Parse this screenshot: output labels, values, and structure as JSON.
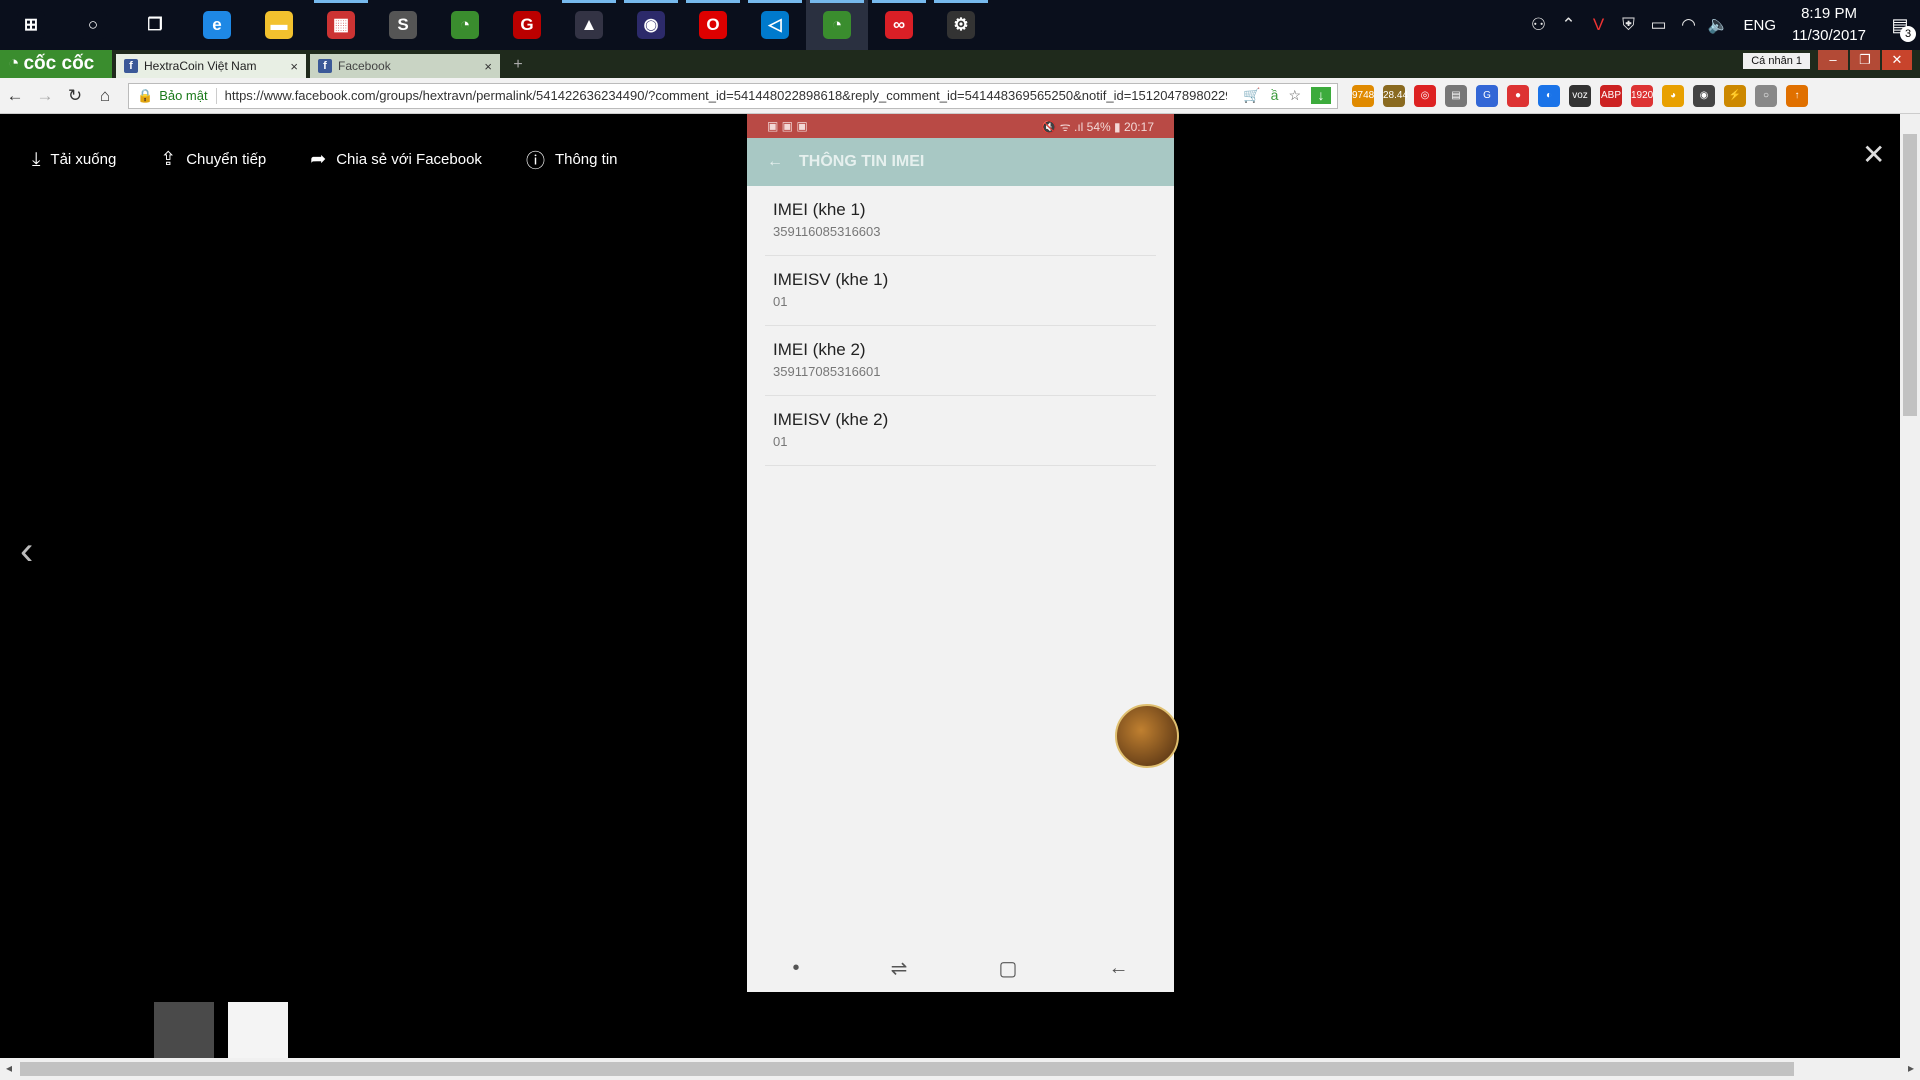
{
  "taskbar": {
    "icons": [
      {
        "name": "start-icon",
        "glyph": "⊞",
        "color": "#0a0f1c"
      },
      {
        "name": "cortana-icon",
        "glyph": "○",
        "color": "#0a0f1c"
      },
      {
        "name": "task-view-icon",
        "glyph": "❐",
        "color": "#0a0f1c"
      },
      {
        "name": "edge-icon",
        "glyph": "e",
        "color": "#1e88e5"
      },
      {
        "name": "file-explorer-icon",
        "glyph": "▬",
        "color": "#f2c12e"
      },
      {
        "name": "app-icon-1",
        "glyph": "▦",
        "color": "#c33"
      },
      {
        "name": "sublime-icon",
        "glyph": "S",
        "color": "#555"
      },
      {
        "name": "coccoc-icon",
        "glyph": "◔",
        "color": "#3a8d2e"
      },
      {
        "name": "garena-icon",
        "glyph": "G",
        "color": "#b00"
      },
      {
        "name": "app-icon-2",
        "glyph": "▲",
        "color": "#334"
      },
      {
        "name": "eclipse-icon",
        "glyph": "◉",
        "color": "#2c2a6a"
      },
      {
        "name": "opera-icon",
        "glyph": "O",
        "color": "#d00"
      },
      {
        "name": "vscode-icon",
        "glyph": "◁",
        "color": "#007acc"
      },
      {
        "name": "coccoc-active-icon",
        "glyph": "◔",
        "color": "#3a8d2e"
      },
      {
        "name": "creative-cloud-icon",
        "glyph": "∞",
        "color": "#da1f26"
      },
      {
        "name": "settings-app-icon",
        "glyph": "⚙",
        "color": "#333"
      }
    ],
    "lang": "ENG",
    "time": "8:19 PM",
    "date": "11/30/2017",
    "notif_count": "3"
  },
  "browser": {
    "brand": "cốc cốc",
    "tabs": [
      {
        "title": "HextraCoin Việt Nam",
        "active": true
      },
      {
        "title": "Facebook",
        "active": false
      }
    ],
    "profile": "Cá nhân 1",
    "secure_label": "Bảo mật",
    "url": "https://www.facebook.com/groups/hextravn/permalink/541422636234490/?comment_id=541448022898618&reply_comment_id=541448369565250&notif_id=151204789802290...",
    "extensions": [
      {
        "label": "9748",
        "color": "#e08a00"
      },
      {
        "label": "28.44",
        "color": "#8a6a20"
      },
      {
        "label": "◎",
        "color": "#d22"
      },
      {
        "label": "▤",
        "color": "#777"
      },
      {
        "label": "G",
        "color": "#3367d6"
      },
      {
        "label": "●",
        "color": "#d33"
      },
      {
        "label": "◐",
        "color": "#1a73e8"
      },
      {
        "label": "voz",
        "color": "#333"
      },
      {
        "label": "ABP",
        "color": "#c22"
      },
      {
        "label": "1920",
        "color": "#d33"
      },
      {
        "label": "◕",
        "color": "#e8a000"
      },
      {
        "label": "◉",
        "color": "#444"
      },
      {
        "label": "⚡",
        "color": "#c80"
      },
      {
        "label": "○",
        "color": "#888"
      },
      {
        "label": "↑",
        "color": "#e07000"
      }
    ]
  },
  "viewer": {
    "actions": [
      {
        "name": "download",
        "icon": "⤓",
        "label": "Tải xuống"
      },
      {
        "name": "forward",
        "icon": "⇪",
        "label": "Chuyển tiếp"
      },
      {
        "name": "share",
        "icon": "➦",
        "label": "Chia sẻ với Facebook"
      },
      {
        "name": "info",
        "icon": "ⓘ",
        "label": "Thông tin"
      }
    ],
    "close": "✕",
    "prev": "‹"
  },
  "phone": {
    "status_left": "▣ ▣ ▣",
    "status_right": "🔇 ᯤ .ıl 54% ▮ 20:17",
    "title": "THÔNG TIN IMEI",
    "items": [
      {
        "label": "IMEI (khe 1)",
        "value": "359116085316603"
      },
      {
        "label": "IMEISV (khe 1)",
        "value": "01"
      },
      {
        "label": "IMEI (khe 2)",
        "value": "359117085316601"
      },
      {
        "label": "IMEISV (khe 2)",
        "value": "01"
      }
    ],
    "nav": [
      "•",
      "⇌",
      "▢",
      "←"
    ]
  }
}
